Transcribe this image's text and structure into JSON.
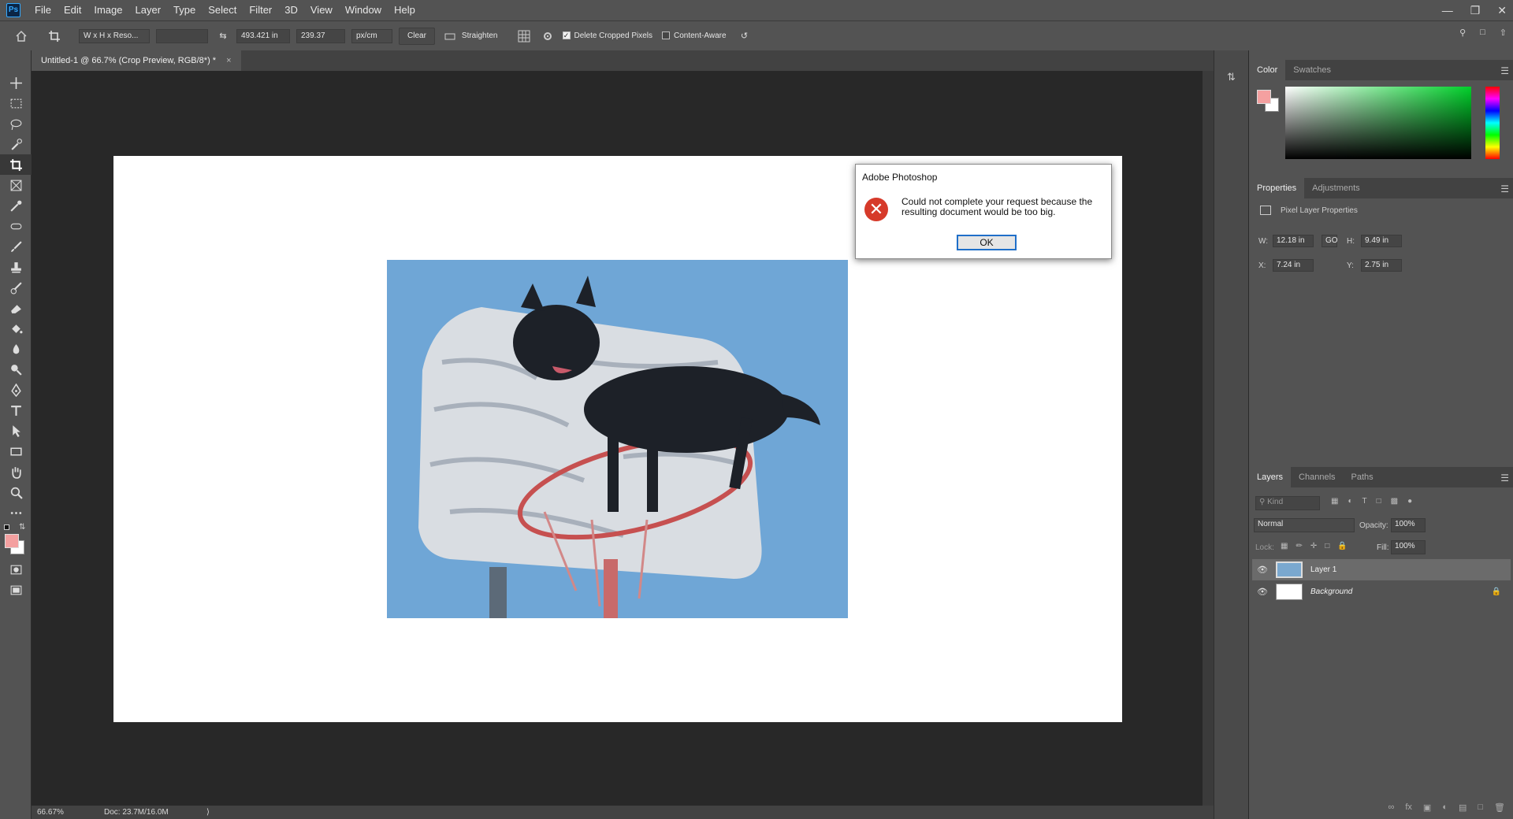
{
  "menubar": {
    "logo": "Ps",
    "items": [
      "File",
      "Edit",
      "Image",
      "Layer",
      "Type",
      "Select",
      "Filter",
      "3D",
      "View",
      "Window",
      "Help"
    ],
    "window_controls": [
      "minimize-icon",
      "restore-icon",
      "close-icon"
    ]
  },
  "options": {
    "preset": "W x H x Reso...",
    "ratio_blank": "",
    "width_value": "493.421 in",
    "height_value": "239.37",
    "unit": "px/cm",
    "clear_label": "Clear",
    "straighten_label": "Straighten",
    "delete_cropped_label": "Delete Cropped Pixels",
    "delete_cropped_checked": true,
    "content_aware_label": "Content-Aware",
    "content_aware_checked": false
  },
  "document": {
    "tab_title": "Untitled-1 @ 66.7% (Crop Preview, RGB/8*) *",
    "zoom": "66.67%",
    "doc_size": "Doc: 23.7M/16.0M"
  },
  "dialog": {
    "title": "Adobe Photoshop",
    "message": "Could not complete your request because the resulting document would be too big.",
    "ok_label": "OK"
  },
  "color_panel": {
    "tabs": [
      "Color",
      "Swatches"
    ],
    "foreground": "#f4a0a0",
    "background": "#ffffff"
  },
  "properties_panel": {
    "tabs": [
      "Properties",
      "Adjustments"
    ],
    "section_title": "Pixel Layer Properties",
    "w_label": "W:",
    "w_value": "12.18 in",
    "link_label": "GO",
    "h_label": "H:",
    "h_value": "9.49 in",
    "x_label": "X:",
    "x_value": "7.24 in",
    "y_label": "Y:",
    "y_value": "2.75 in"
  },
  "layers_panel": {
    "tabs": [
      "Layers",
      "Channels",
      "Paths"
    ],
    "kind_placeholder": "Kind",
    "blend_mode": "Normal",
    "opacity_label": "Opacity:",
    "opacity_value": "100%",
    "lock_label": "Lock:",
    "fill_label": "Fill:",
    "fill_value": "100%",
    "layers": [
      {
        "name": "Layer 1",
        "selected": true
      },
      {
        "name": "Background",
        "selected": false,
        "locked": true
      }
    ]
  }
}
